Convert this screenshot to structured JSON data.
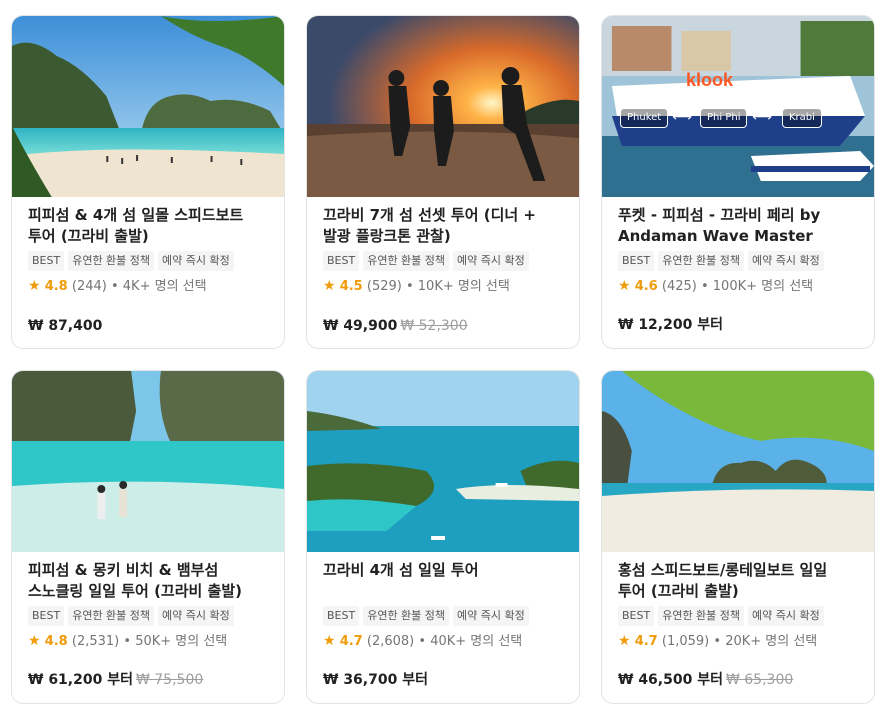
{
  "cards": [
    {
      "title": "피피섬 & 4개 섬 일몰 스피드보트 투어 (끄라비 출발)",
      "tags": [
        "BEST",
        "유연한 환불 정책",
        "예약 즉시 확정"
      ],
      "rating": "4.8",
      "reviews": "(244)",
      "booked": "• 4K+ 명의 선택",
      "price": "₩ 87,400",
      "original_price": ""
    },
    {
      "title": "끄라비 7개 섬 선셋 투어 (디너 + 발광 플랑크톤 관찰)",
      "tags": [
        "BEST",
        "유연한 환불 정책",
        "예약 즉시 확정"
      ],
      "rating": "4.5",
      "reviews": "(529)",
      "booked": "• 10K+ 명의 선택",
      "price": "₩ 49,900",
      "original_price": "₩ 52,300"
    },
    {
      "title": "푸켓 - 피피섬 - 끄라비 페리 by Andaman Wave Master",
      "tags": [
        "BEST",
        "유연한 환불 정책",
        "예약 즉시 확정"
      ],
      "rating": "4.6",
      "reviews": "(425)",
      "booked": "• 100K+ 명의 선택",
      "price": "₩ 12,200 부터",
      "original_price": "",
      "image_labels": {
        "brand": "klook",
        "from": "Phuket",
        "via": "Phi Phi",
        "to": "Krabi"
      }
    },
    {
      "title": "피피섬 & 몽키 비치 & 뱀부섬 스노클링 일일 투어 (끄라비 출발)",
      "tags": [
        "BEST",
        "유연한 환불 정책",
        "예약 즉시 확정"
      ],
      "rating": "4.8",
      "reviews": "(2,531)",
      "booked": "• 50K+ 명의 선택",
      "price": "₩ 61,200 부터",
      "original_price": "₩ 75,500"
    },
    {
      "title": "끄라비 4개 섬 일일 투어",
      "tags": [
        "BEST",
        "유연한 환불 정책",
        "예약 즉시 확정"
      ],
      "rating": "4.7",
      "reviews": "(2,608)",
      "booked": "• 40K+ 명의 선택",
      "price": "₩ 36,700 부터",
      "original_price": ""
    },
    {
      "title": "홍섬 스피드보트/롱테일보트 일일 투어 (끄라비 출발)",
      "tags": [
        "BEST",
        "유연한 환불 정책",
        "예약 즉시 확정"
      ],
      "rating": "4.7",
      "reviews": "(1,059)",
      "booked": "• 20K+ 명의 선택",
      "price": "₩ 46,500 부터",
      "original_price": "₩ 65,300"
    }
  ]
}
